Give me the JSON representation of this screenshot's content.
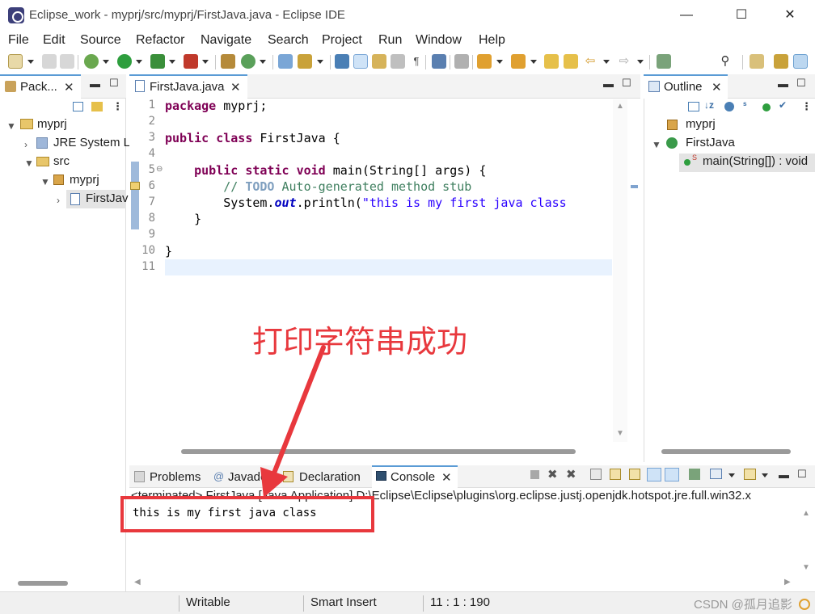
{
  "window": {
    "title": "Eclipse_work - myprj/src/myprj/FirstJava.java - Eclipse IDE",
    "minimize": "—",
    "maximize": "☐",
    "close": "✕"
  },
  "menu": [
    "File",
    "Edit",
    "Source",
    "Refactor",
    "Navigate",
    "Search",
    "Project",
    "Run",
    "Window",
    "Help"
  ],
  "package_explorer": {
    "tab_label": "Pack...",
    "tree": [
      {
        "label": "myprj",
        "icon": "project-icon",
        "twisty": "v"
      },
      {
        "label": "JRE System L",
        "icon": "library-icon",
        "twisty": ">"
      },
      {
        "label": "src",
        "icon": "folder-icon",
        "twisty": "v"
      },
      {
        "label": "myprj",
        "icon": "package-icon",
        "twisty": "v"
      },
      {
        "label": "FirstJav",
        "icon": "java-file-icon",
        "twisty": ">"
      }
    ]
  },
  "editor": {
    "tab_label": "FirstJava.java",
    "line_numbers": [
      "1",
      "2",
      "3",
      "4",
      "5",
      "6",
      "7",
      "8",
      "9",
      "10",
      "11"
    ],
    "lines": {
      "l1_kw": "package",
      "l1_rest": " myprj;",
      "l3_kw1": "public",
      "l3_sp": " ",
      "l3_kw2": "class",
      "l3_rest": " FirstJava {",
      "l5_indent": "    ",
      "l5_kw1": "public",
      "l5_kw2": "static",
      "l5_kw3": "void",
      "l5_rest": " main(String[] args) {",
      "l6_indent": "        ",
      "l6_slashes": "// ",
      "l6_todo": "TODO",
      "l6_rest": " Auto-generated method stub",
      "l7_indent": "        ",
      "l7_a": "System.",
      "l7_field": "out",
      "l7_b": ".println(",
      "l7_str": "\"this is my first java class",
      "l8": "    }",
      "l10": "}"
    }
  },
  "outline": {
    "tab_label": "Outline",
    "items": [
      {
        "label": "myprj",
        "icon": "package-icon"
      },
      {
        "label": "FirstJava",
        "icon": "class-icon"
      },
      {
        "label": "main(String[]) : void",
        "icon": "method-icon"
      }
    ]
  },
  "bottom_tabs": [
    "Problems",
    "Javadoc",
    "Declaration",
    "Console"
  ],
  "console": {
    "header": "<terminated> FirstJava [Java Application] D:\\Eclipse\\Eclipse\\plugins\\org.eclipse.justj.openjdk.hotspot.jre.full.win32.x",
    "output": "this is my first java class"
  },
  "annotation": {
    "text": "打印字符串成功",
    "color": "#e8383d"
  },
  "status": {
    "writable": "Writable",
    "insert_mode": "Smart Insert",
    "position": "11 : 1 : 190"
  },
  "watermark": "CSDN @孤月追影",
  "colors": {
    "keyword": "#7f0055",
    "comment": "#3f7f5f",
    "string": "#2a00ff",
    "tab_accent": "#5a9bd5",
    "annotation_red": "#e8383d"
  }
}
